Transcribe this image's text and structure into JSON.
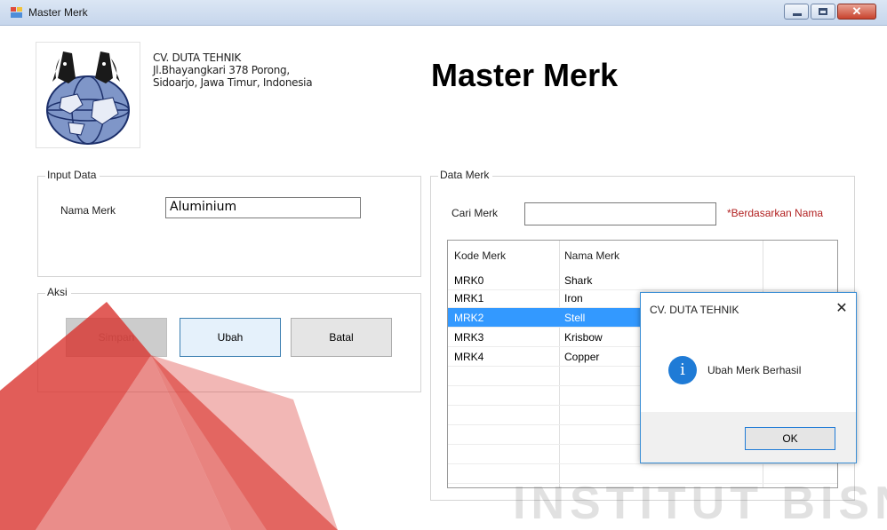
{
  "window": {
    "title": "Master Merk",
    "close_glyph": "✕"
  },
  "header": {
    "company_name": "CV. DUTA TEHNIK",
    "address_line1": "Jl.Bhayangkari 378 Porong,",
    "address_line2": "Sidoarjo, Jawa Timur, Indonesia",
    "page_title": "Master Merk",
    "logo_icon": "company-logo-icon"
  },
  "input_data": {
    "group_label": "Input Data",
    "nama_merk_label": "Nama Merk",
    "nama_merk_value": "Aluminium"
  },
  "aksi": {
    "group_label": "Aksi",
    "simpan_label": "Simpan",
    "ubah_label": "Ubah",
    "batal_label": "Batal"
  },
  "data_merk": {
    "group_label": "Data Merk",
    "search_label": "Cari Merk",
    "search_value": "",
    "search_hint": "*Berdasarkan Nama",
    "columns": [
      "Kode Merk",
      "Nama Merk"
    ],
    "rows": [
      {
        "kode": "MRK0",
        "nama": "Shark"
      },
      {
        "kode": "MRK1",
        "nama": "Iron"
      },
      {
        "kode": "MRK2",
        "nama": "Stell"
      },
      {
        "kode": "MRK3",
        "nama": "Krisbow"
      },
      {
        "kode": "MRK4",
        "nama": "Copper"
      }
    ],
    "selected_row": 2
  },
  "dialog": {
    "title": "CV. DUTA TEHNIK",
    "close_glyph": "✕",
    "message": "Ubah Merk Berhasil",
    "info_glyph": "i",
    "ok_label": "OK"
  },
  "watermark": {
    "text": "INSTITUT BISNIS"
  },
  "colors": {
    "selection": "#3399ff",
    "hint": "#b22222",
    "dialog_border": "#3b8fd6",
    "info_icon": "#1f7bd6",
    "watermark_red": "#d9302a"
  }
}
